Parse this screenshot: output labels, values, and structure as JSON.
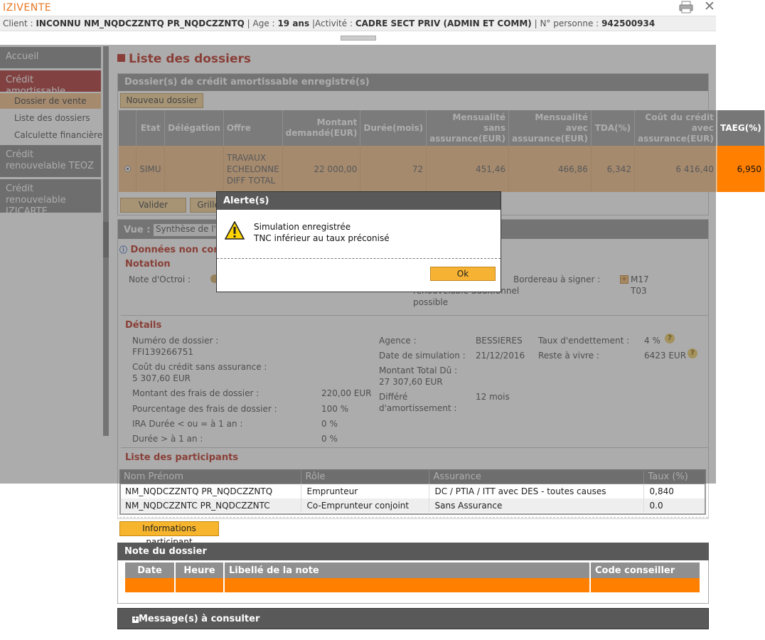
{
  "app": {
    "title": "IZIVENTE"
  },
  "client": {
    "label_client": "Client :",
    "name": "INCONNU NM_NQDCZZNTQ PR_NQDCZZNTQ",
    "label_age": "Age :",
    "age": "19 ans",
    "label_activite": "|Activité :",
    "activite": "CADRE SECT PRIV (ADMIN ET COMM)",
    "label_personne": "N° personne :",
    "personne": "942500934"
  },
  "sidebar": {
    "items": [
      {
        "label": "Accueil"
      },
      {
        "label": "Crédit amortissable"
      },
      {
        "label": "Crédit renouvelable TEOZ"
      },
      {
        "label": "Crédit renouvelable IZICARTE"
      }
    ],
    "subitems": [
      {
        "label": "Dossier de vente"
      },
      {
        "label": "Liste des dossiers"
      },
      {
        "label": "Calculette financière"
      }
    ]
  },
  "page": {
    "title": "Liste des dossiers"
  },
  "dossiers": {
    "section_title": "Dossier(s) de crédit amortissable enregistré(s)",
    "new_button": "Nouveau dossier",
    "headers": [
      "Etat",
      "Délégation",
      "Offre",
      "Montant demandé(EUR)",
      "Durée(mois)",
      "Mensualité sans assurance(EUR)",
      "Mensualité avec assurance(EUR)",
      "TDA(%)",
      "Coût du crédit avec assurance(EUR)",
      "TAEG(%)"
    ],
    "row": {
      "etat": "SIMU",
      "delegation": "",
      "offre": "TRAVAUX ECHELONNE DIFF TOTAL",
      "montant": "22 000,00",
      "duree": "72",
      "mens_sans": "451,46",
      "mens_avec": "466,86",
      "tda": "6,342",
      "cout": "6 416,40",
      "taeg": "6,950"
    },
    "valider": "Valider",
    "grille": "Grille"
  },
  "vue": {
    "label": "Vue :",
    "value": "Synthèse de l'o"
  },
  "status": {
    "donnees": "Données non cont"
  },
  "notation": {
    "title": "Notation",
    "note_octroi": "Note d'Octroi :",
    "bordereau_label": "Bordereau à signer :",
    "bordereau_value1": "M17",
    "bordereau_value2": "T03",
    "autres_text1": "renouvelable additionnel",
    "autres_text2": "possible"
  },
  "details": {
    "title": "Détails",
    "numero_label": "Numéro de dossier :",
    "numero_value": "FFI139266751",
    "cout_label": "Coût du crédit sans assurance :",
    "cout_value": "5 307,60 EUR",
    "frais_label": "Montant des frais de dossier :",
    "frais_value": "220,00 EUR",
    "pourc_label": "Pourcentage des frais de dossier :",
    "pourc_value": "100 %",
    "ira1_label": "IRA Durée < ou = à 1 an :",
    "ira1_value": "0 %",
    "ira2_label": "Durée > à 1 an :",
    "ira2_value": "0 %",
    "agence_label": "Agence :",
    "agence_value": "BESSIERES",
    "date_label": "Date de simulation :",
    "date_value": "21/12/2016",
    "total_label": "Montant Total Dû :",
    "total_value": "27 307,60 EUR",
    "diff_label1": "Différé",
    "diff_label2": "d'amortissement :",
    "diff_value": "12 mois",
    "taux_label": "Taux d'endettement :",
    "taux_value": "4 %",
    "reste_label": "Reste à vivre :",
    "reste_value": "6423 EUR"
  },
  "participants": {
    "title": "Liste des participants",
    "headers": [
      "Nom Prénom",
      "Rôle",
      "Assurance",
      "Taux (%)"
    ],
    "rows": [
      {
        "nom": "NM_NQDCZZNTQ PR_NQDCZZNTQ",
        "role": "Emprunteur",
        "assurance": "DC / PTIA / ITT avec DES - toutes causes",
        "taux": "0,840"
      },
      {
        "nom": "NM_NQDCZZNTC PR_NQDCZZNTC",
        "role": "Co-Emprunteur conjoint",
        "assurance": "Sans Assurance",
        "taux": "0.0"
      }
    ],
    "info_button": "Informations participant"
  },
  "note": {
    "title": "Note du dossier",
    "headers": [
      "Date",
      "Heure",
      "Libellé de la note",
      "Code conseiller"
    ]
  },
  "messages": {
    "title": "Message(s) à consulter"
  },
  "alert": {
    "title": "Alerte(s)",
    "line1": "Simulation enregistrée",
    "line2": "TNC inférieur au taux préconisé",
    "ok": "Ok"
  },
  "colors": {
    "accent": "#c0392b",
    "orange": "#ff7f00",
    "peach": "#f2c28f",
    "header_gray": "#9a9a9a"
  },
  "icons": [
    "print-icon",
    "close-icon",
    "warning-icon",
    "info-icon",
    "help-icon",
    "plus-icon",
    "radio-icon"
  ]
}
